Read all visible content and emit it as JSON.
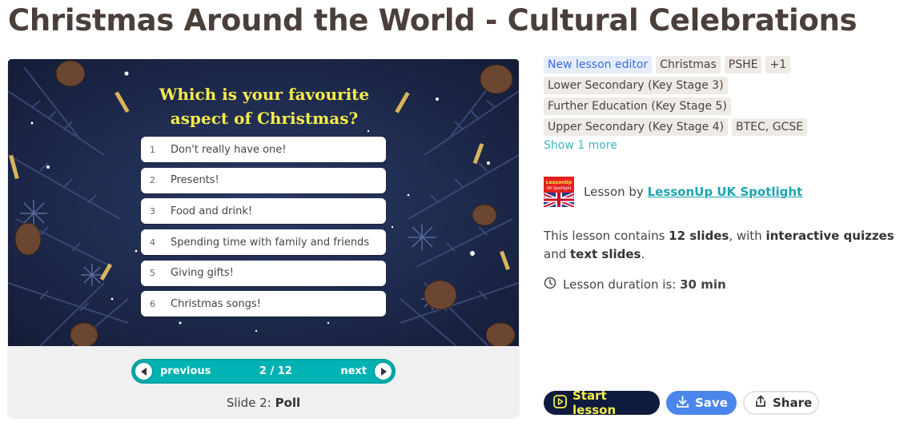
{
  "page": {
    "title": "Christmas Around the World - Cultural Celebrations"
  },
  "slide": {
    "question": "Which is your favourite aspect of Christmas?",
    "options": [
      {
        "num": "1",
        "text": "Don't really have one!"
      },
      {
        "num": "2",
        "text": "Presents!"
      },
      {
        "num": "3",
        "text": "Food and drink!"
      },
      {
        "num": "4",
        "text": "Spending time with family and friends"
      },
      {
        "num": "5",
        "text": "Giving gifts!"
      },
      {
        "num": "6",
        "text": "Christmas songs!"
      }
    ]
  },
  "nav": {
    "previous_label": "previous",
    "counter": "2 / 12",
    "next_label": "next"
  },
  "caption": {
    "prefix": "Slide 2:",
    "type": "Poll"
  },
  "tags": {
    "row1": [
      "New lesson editor",
      "Christmas",
      "PSHE",
      "+1"
    ],
    "row2": [
      "Lower Secondary (Key Stage 3)"
    ],
    "row3": [
      "Further Education (Key Stage 5)"
    ],
    "row4": [
      "Upper Secondary (Key Stage 4)",
      "BTEC, GCSE"
    ],
    "show_more": "Show 1 more"
  },
  "author": {
    "prefix": "Lesson by",
    "name": "LessonUp UK Spotlight",
    "logo_text_1": "LessonUp",
    "logo_text_2": "UK Spotlight"
  },
  "description": {
    "part1": "This lesson contains ",
    "slides": "12 slides",
    "part2": ", with ",
    "quizzes": "interactive quizzes",
    "part3": " and ",
    "text_slides": "text slides",
    "part4": "."
  },
  "duration": {
    "label": "Lesson duration is:",
    "value": "30 min"
  },
  "actions": {
    "start": "Start lesson",
    "save": "Save",
    "share": "Share"
  },
  "colors": {
    "accent_teal": "#00b2b2",
    "start_bg": "#0f1b3c",
    "start_text": "#f6ec4a",
    "save_bg": "#4a86ec"
  }
}
